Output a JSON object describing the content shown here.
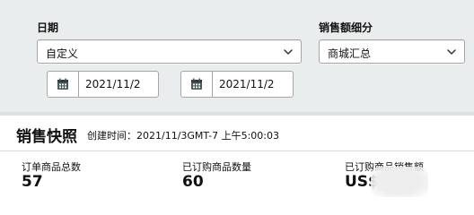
{
  "filters": {
    "date_label": "日期",
    "date_range_value": "自定义",
    "start_date": "2021/11/2",
    "end_date": "2021/11/2",
    "breakdown_label": "销售额细分",
    "breakdown_value": "商城汇总"
  },
  "snapshot": {
    "title": "销售快照",
    "created": "创建时间：2021/11/3GMT-7 上午5:00:03",
    "metrics": [
      {
        "label": "订单商品总数",
        "value": "57"
      },
      {
        "label": "已订购商品数量",
        "value": "60"
      },
      {
        "label": "已订购商品销售额",
        "value": "US$"
      }
    ]
  },
  "colors": {
    "panel_background": "#eaeded",
    "border": "#a6a6a6",
    "calendar_icon": "#4a5a5d"
  },
  "icons": {
    "calendar": "calendar-icon",
    "chevron": "chevron-down-icon"
  }
}
